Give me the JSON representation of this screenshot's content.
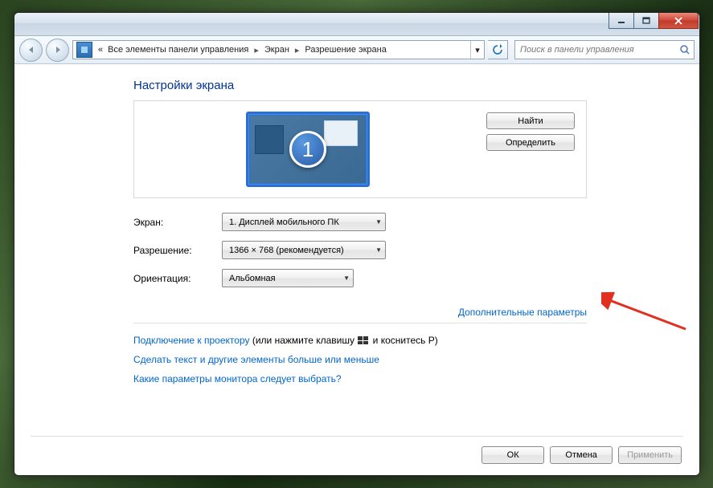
{
  "breadcrumb": {
    "prefix": "«",
    "item1": "Все элементы панели управления",
    "item2": "Экран",
    "item3": "Разрешение экрана"
  },
  "search": {
    "placeholder": "Поиск в панели управления"
  },
  "heading": "Настройки экрана",
  "monitor_number": "1",
  "buttons": {
    "find": "Найти",
    "detect": "Определить",
    "ok": "ОК",
    "cancel": "Отмена",
    "apply": "Применить"
  },
  "rows": {
    "screen_label": "Экран:",
    "screen_value": "1. Дисплей мобильного ПК",
    "resolution_label": "Разрешение:",
    "resolution_value": "1366 × 768 (рекомендуется)",
    "orientation_label": "Ориентация:",
    "orientation_value": "Альбомная"
  },
  "links": {
    "advanced": "Дополнительные параметры",
    "projector": "Подключение к проектору",
    "projector_tail1": " (или нажмите клавишу ",
    "projector_tail2": " и коснитесь P)",
    "textsize": "Сделать текст и другие элементы больше или меньше",
    "whichmon": "Какие параметры монитора следует выбрать?"
  }
}
